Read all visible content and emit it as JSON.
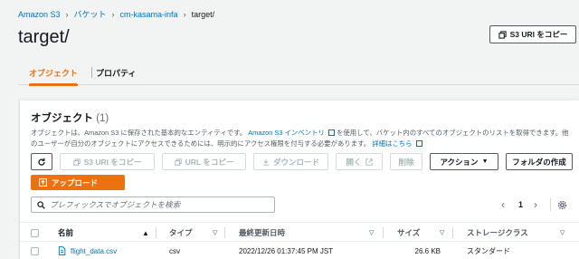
{
  "breadcrumb": [
    "Amazon S3",
    "バケット",
    "cm-kasama-infa",
    "target/"
  ],
  "page_title": "target/",
  "copy_uri_button": "S3 URI をコピー",
  "tabs": [
    {
      "label": "オブジェクト",
      "active": true
    },
    {
      "label": "プロパティ",
      "active": false
    }
  ],
  "objects_panel": {
    "title": "オブジェクト",
    "count": "(1)",
    "desc_part1": "オブジェクトは、Amazon S3 に保存された基本的なエンティティです。",
    "desc_link1": "Amazon S3 インベントリ",
    "desc_part2": "を使用して、バケット内のすべてのオブジェクトのリストを取得できます。他のユーザーが自分のオブジェクトにアクセスできるためには、明示的にアクセス権限を付与する必要があります。",
    "desc_link2": "詳細はこちら"
  },
  "toolbar": {
    "copy_s3_uri": "S3 URI をコピー",
    "copy_url": "URL をコピー",
    "download": "ダウンロード",
    "open": "開く",
    "delete": "削除",
    "actions": "アクション",
    "create_folder": "フォルダの作成",
    "upload": "アップロード"
  },
  "search": {
    "placeholder": "プレフィックスでオブジェクトを検索"
  },
  "pagination": {
    "page": "1"
  },
  "table": {
    "columns": [
      "名前",
      "タイプ",
      "最終更新日時",
      "サイズ",
      "ストレージクラス"
    ],
    "rows": [
      {
        "name": "flight_data.csv",
        "type": "csv",
        "modified": "2022/12/26 01:37:45 PM JST",
        "size": "26.6 KB",
        "storage_class": "スタンダード"
      }
    ]
  },
  "colors": {
    "accent": "#ec7211",
    "link": "#0073bb"
  },
  "icons": [
    "refresh-icon",
    "copy-icon",
    "download-icon",
    "external-link-icon",
    "caret-down-icon",
    "upload-icon",
    "search-icon",
    "chevron-left-icon",
    "chevron-right-icon",
    "gear-icon",
    "file-icon",
    "sort-icon"
  ]
}
